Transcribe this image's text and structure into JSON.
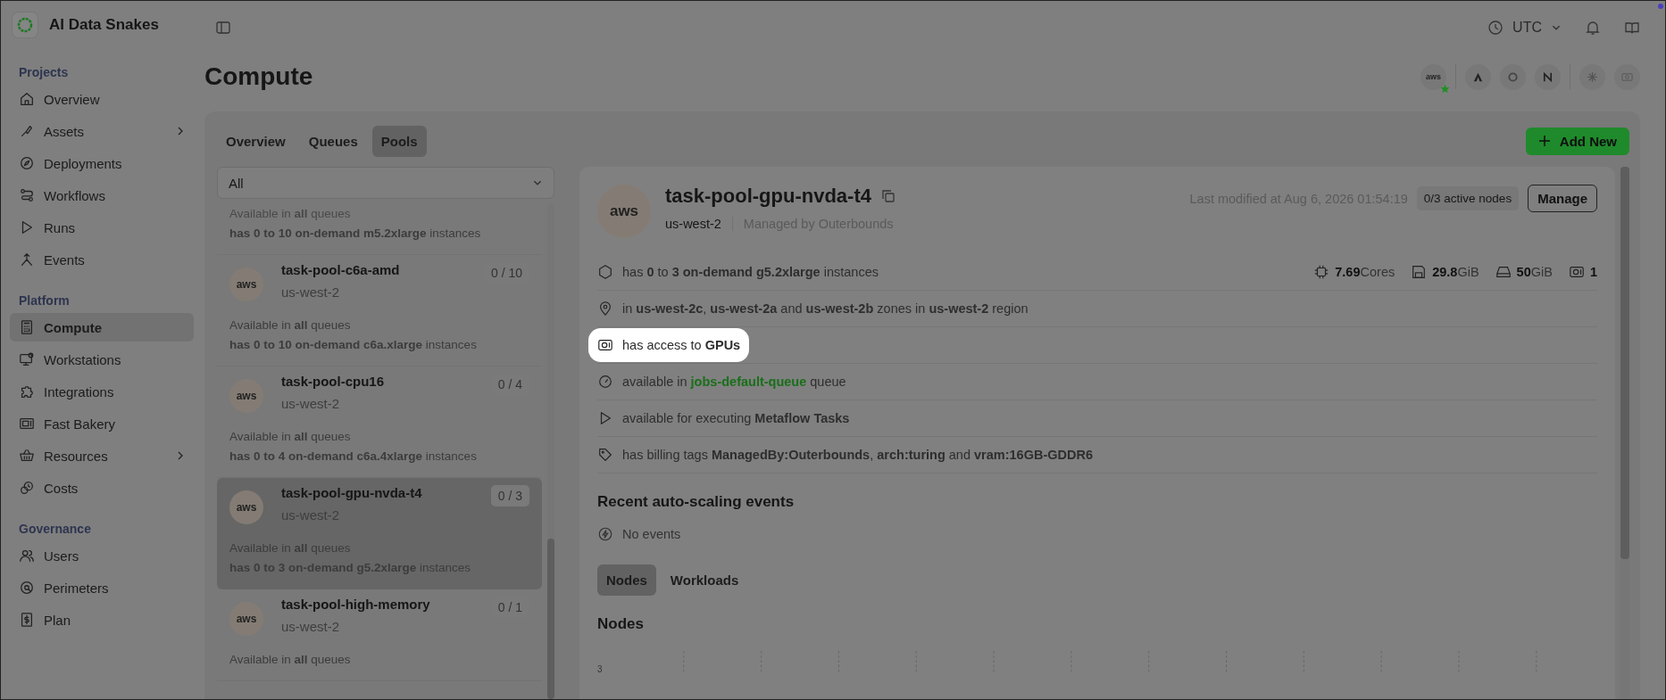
{
  "brand": {
    "name": "AI Data Snakes"
  },
  "sidebar": {
    "sections": [
      {
        "title": "Projects",
        "items": [
          {
            "label": "Overview",
            "selected": false,
            "expandable": false
          },
          {
            "label": "Assets",
            "selected": false,
            "expandable": true
          },
          {
            "label": "Deployments",
            "selected": false,
            "expandable": false
          },
          {
            "label": "Workflows",
            "selected": false,
            "expandable": false
          },
          {
            "label": "Runs",
            "selected": false,
            "expandable": false
          },
          {
            "label": "Events",
            "selected": false,
            "expandable": false
          }
        ]
      },
      {
        "title": "Platform",
        "items": [
          {
            "label": "Compute",
            "selected": true,
            "expandable": false
          },
          {
            "label": "Workstations",
            "selected": false,
            "expandable": false
          },
          {
            "label": "Integrations",
            "selected": false,
            "expandable": false
          },
          {
            "label": "Fast Bakery",
            "selected": false,
            "expandable": false
          },
          {
            "label": "Resources",
            "selected": false,
            "expandable": true
          },
          {
            "label": "Costs",
            "selected": false,
            "expandable": false
          }
        ]
      },
      {
        "title": "Governance",
        "items": [
          {
            "label": "Users",
            "selected": false,
            "expandable": false
          },
          {
            "label": "Perimeters",
            "selected": false,
            "expandable": false
          },
          {
            "label": "Plan",
            "selected": false,
            "expandable": false
          }
        ]
      }
    ]
  },
  "topbar": {
    "timezone": "UTC"
  },
  "page": {
    "title": "Compute"
  },
  "providers": [
    {
      "kind": "aws",
      "logo": "aws",
      "starred": true
    },
    {
      "kind": "a",
      "starred": false
    },
    {
      "kind": "ring",
      "starred": false
    },
    {
      "kind": "n",
      "starred": false
    },
    {
      "kind": "snow",
      "starred": false
    },
    {
      "kind": "gpu",
      "starred": false
    }
  ],
  "tabs": [
    {
      "label": "Overview",
      "selected": false
    },
    {
      "label": "Queues",
      "selected": false
    },
    {
      "label": "Pools",
      "selected": true
    }
  ],
  "add_button": {
    "label": "Add New"
  },
  "filter": {
    "value": "All"
  },
  "pools": [
    {
      "lines": [
        "Available in **all** queues",
        "**has 0 to 10 on-demand m5.2xlarge** instances"
      ],
      "selected": false,
      "faded_first": true
    },
    {
      "logo": "aws",
      "name": "task-pool-c6a-amd",
      "region": "us-west-2",
      "count": "0 / 10",
      "lines": [
        "Available in **all** queues",
        "**has 0 to 10 on-demand c6a.xlarge** instances"
      ],
      "selected": false,
      "faded_first": false
    },
    {
      "logo": "aws",
      "name": "task-pool-cpu16",
      "region": "us-west-2",
      "count": "0 / 4",
      "lines": [
        "Available in **all** queues",
        "**has 0 to 4 on-demand c6a.4xlarge** instances"
      ],
      "selected": false,
      "faded_first": false
    },
    {
      "logo": "aws",
      "name": "task-pool-gpu-nvda-t4",
      "region": "us-west-2",
      "count": "0 / 3",
      "lines": [
        "Available in **all** queues",
        "**has 0 to 3 on-demand g5.2xlarge** instances"
      ],
      "selected": true,
      "faded_first": false
    },
    {
      "logo": "aws",
      "name": "task-pool-high-memory",
      "region": "us-west-2",
      "count": "0 / 1",
      "lines": [
        "Available in **all** queues"
      ],
      "selected": false,
      "faded_first": false
    }
  ],
  "detail": {
    "logo": "aws",
    "name": "task-pool-gpu-nvda-t4",
    "region": "us-west-2",
    "managed_by": "Managed by Outerbounds",
    "last_modified": "Last modified at Aug 6, 2026 01:54:19",
    "active_nodes": "0/3 active nodes",
    "manage_button": "Manage",
    "resources": [
      {
        "value": "7.69",
        "unit": "Cores"
      },
      {
        "value": "29.8",
        "unit": "GiB"
      },
      {
        "value": "50",
        "unit": "GiB"
      },
      {
        "value": "1"
      }
    ],
    "facts": [
      {
        "kind": "text",
        "text": "has **0** to **3** **on-demand g5.2xlarge** instances",
        "highlighted": false
      },
      {
        "kind": "text",
        "text": "in **us-west-2c**, **us-west-2a** and **us-west-2b** zones in **us-west-2** region",
        "highlighted": false
      },
      {
        "kind": "text",
        "text": "has access to **GPUs**",
        "highlighted": true
      },
      {
        "kind": "link",
        "prefix": "available in",
        "link": "jobs-default-queue",
        "suffix": "queue",
        "highlighted": false
      },
      {
        "kind": "text",
        "text": "available for executing **Metaflow Tasks**",
        "highlighted": false
      },
      {
        "kind": "text",
        "text": "has billing tags **ManagedBy:Outerbounds**, **arch:turing** and **vram:16GB-GDDR6**",
        "highlighted": false
      }
    ],
    "events_title": "Recent auto-scaling events",
    "events_empty": "No events",
    "subtabs": [
      {
        "label": "Nodes",
        "selected": true
      },
      {
        "label": "Workloads",
        "selected": false
      }
    ],
    "nodes_title": "Nodes",
    "chart_tick": "3"
  }
}
